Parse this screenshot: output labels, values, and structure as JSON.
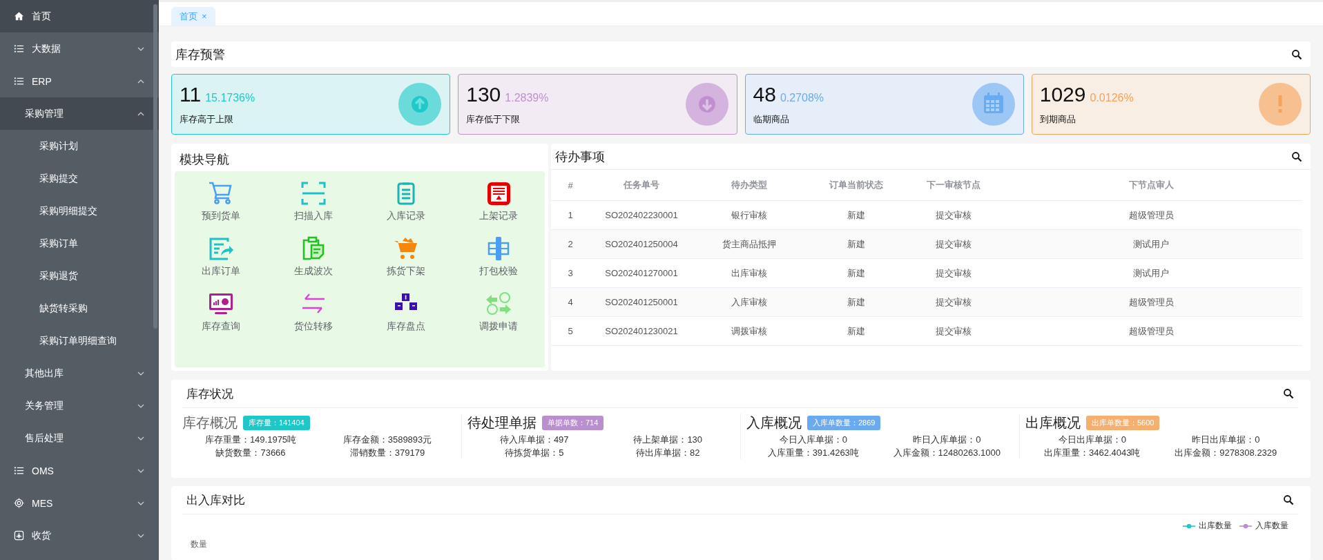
{
  "sidebar": {
    "items": [
      {
        "label": "首页",
        "selected": true
      },
      {
        "label": "大数据",
        "selected": false,
        "expanded": false
      },
      {
        "label": "ERP",
        "selected": false,
        "expanded": true,
        "children": [
          {
            "label": "采购管理",
            "selected": true,
            "expanded": true,
            "children": [
              {
                "label": "采购计划",
                "selected": false
              },
              {
                "label": "采购提交",
                "selected": false
              },
              {
                "label": "采购明细提交",
                "selected": false
              },
              {
                "label": "采购订单",
                "selected": false
              },
              {
                "label": "采购退货",
                "selected": false
              },
              {
                "label": "缺货转采购",
                "selected": false
              },
              {
                "label": "采购订单明细查询",
                "selected": false
              }
            ]
          },
          {
            "label": "其他出库",
            "selected": false,
            "expanded": false
          },
          {
            "label": "关务管理",
            "selected": false,
            "expanded": false
          },
          {
            "label": "售后处理",
            "selected": false,
            "expanded": false
          }
        ]
      },
      {
        "label": "OMS",
        "selected": false,
        "expanded": false
      },
      {
        "label": "MES",
        "selected": false,
        "expanded": false
      },
      {
        "label": "收货",
        "selected": false,
        "expanded": false
      }
    ]
  },
  "tabs": [
    {
      "label": "首页",
      "close": "×",
      "selected": true
    }
  ],
  "stock_alert": {
    "title": "库存预警",
    "cards": [
      {
        "value": "11",
        "percent": "15.1736%",
        "label": "库存高于上限",
        "color": "#20c9c9"
      },
      {
        "value": "130",
        "percent": "1.2839%",
        "label": "库存低于下限",
        "color": "#c08fd0"
      },
      {
        "value": "48",
        "percent": "0.2708%",
        "label": "临期商品",
        "color": "#6aaaf0"
      },
      {
        "value": "1029",
        "percent": "0.0126%",
        "label": "到期商品",
        "color": "#f5a25a"
      }
    ]
  },
  "module_nav": {
    "title": "模块导航",
    "items": [
      "预到货单",
      "扫描入库",
      "入库记录",
      "上架记录",
      "出库订单",
      "生成波次",
      "拣货下架",
      "打包校验",
      "库存查询",
      "货位转移",
      "库存盘点",
      "调拨申请"
    ]
  },
  "todo": {
    "title": "待办事项",
    "columns": [
      "#",
      "任务单号",
      "待办类型",
      "订单当前状态",
      "下一审核节点",
      "下节点审人"
    ],
    "rows": [
      [
        "1",
        "SO202402230001",
        "银行审核",
        "新建",
        "提交审核",
        "超级管理员"
      ],
      [
        "2",
        "SO202401250004",
        "货主商品抵押",
        "新建",
        "提交审核",
        "测试用户"
      ],
      [
        "3",
        "SO202401270001",
        "出库审核",
        "新建",
        "提交审核",
        "测试用户"
      ],
      [
        "4",
        "SO202401250001",
        "入库审核",
        "新建",
        "提交审核",
        "超级管理员"
      ],
      [
        "5",
        "SO202401230021",
        "调拨审核",
        "新建",
        "提交审核",
        "超级管理员"
      ]
    ]
  },
  "stock_status": {
    "title": "库存状况",
    "sections": [
      {
        "title": "库存概况",
        "badge": "库存量：141404",
        "color": "#1fc8c8",
        "stats": [
          "库存重量：149.1975吨",
          "库存金额：3589893元",
          "缺货数量：73666",
          "滞销数量：379179"
        ]
      },
      {
        "title": "待处理单据",
        "badge": "单据单数：714",
        "color": "#b98fd0",
        "stats": [
          "待入库单据：497",
          "待上架单据：130",
          "待拣货单据：5",
          "待出库单据：82"
        ]
      },
      {
        "title": "入库概况",
        "badge": "入库单数量：2869",
        "color": "#6aaaf0",
        "stats": [
          "今日入库单据：0",
          "昨日入库单据：0",
          "入库重量：391.4263吨",
          "入库金额：12480263.1000"
        ]
      },
      {
        "title": "出库概况",
        "badge": "出库单数量：5600",
        "color": "#f5b070",
        "stats": [
          "今日出库单据：0",
          "昨日出库单据：0",
          "出库重量：3462.4043吨",
          "出库金额：9278308.2329"
        ]
      }
    ]
  },
  "io_compare": {
    "title": "出入库对比",
    "legend": [
      {
        "label": "出库数量",
        "color": "#20c9c9"
      },
      {
        "label": "入库数量",
        "color": "#b98fd0"
      }
    ],
    "y_axis_label": "数量"
  }
}
